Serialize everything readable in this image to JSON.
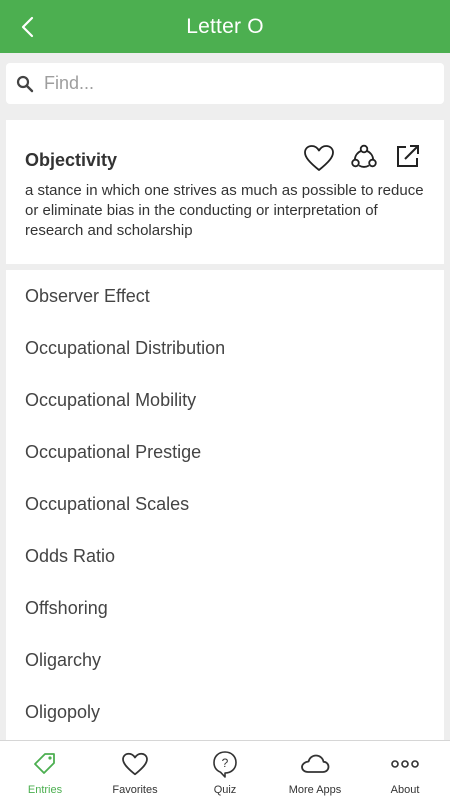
{
  "header": {
    "title": "Letter O"
  },
  "search": {
    "placeholder": "Find..."
  },
  "entry": {
    "term": "Objectivity",
    "definition": "a stance in which one strives as much as possible to reduce or eliminate bias in the conducting or interpretation of research and scholarship"
  },
  "list": {
    "items": [
      "Observer Effect",
      "Occupational Distribution",
      "Occupational Mobility",
      "Occupational Prestige",
      "Occupational Scales",
      "Odds Ratio",
      "Offshoring",
      "Oligarchy",
      "Oligopoly"
    ]
  },
  "nav": {
    "items": [
      {
        "label": "Entries",
        "icon": "tag-icon",
        "active": true
      },
      {
        "label": "Favorites",
        "icon": "heart-icon",
        "active": false
      },
      {
        "label": "Quiz",
        "icon": "question-bubble-icon",
        "active": false
      },
      {
        "label": "More Apps",
        "icon": "cloud-icon",
        "active": false
      },
      {
        "label": "About",
        "icon": "more-dots-icon",
        "active": false
      }
    ]
  },
  "colors": {
    "accent": "#4caf50",
    "text": "#333333",
    "background": "#eeeeee"
  }
}
